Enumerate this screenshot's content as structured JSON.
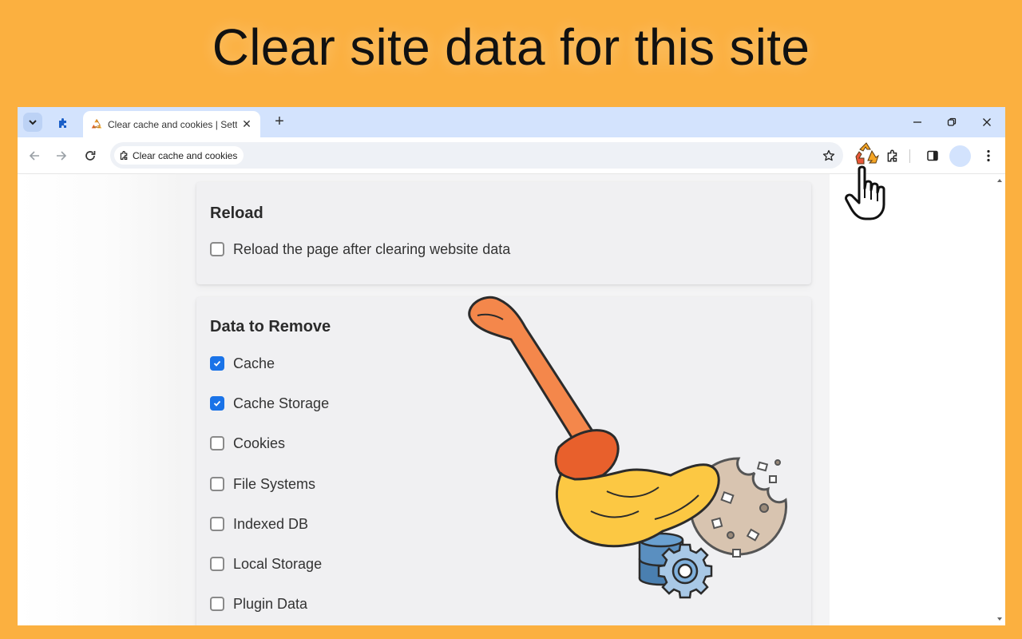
{
  "headline": "Clear site data for this site",
  "browser": {
    "tab": {
      "title": "Clear cache and cookies | Settings",
      "favicon": "recycle-icon"
    },
    "tabbar_icons": [
      "tab-search-icon",
      "extension-puzzle-icon",
      "new-tab-icon"
    ],
    "window_controls": [
      "minimize",
      "restore",
      "close"
    ],
    "toolbar": {
      "back": "arrow-left-icon",
      "forward": "arrow-right-icon",
      "reload": "reload-icon",
      "omnibox_chip_label": "Clear cache and cookies",
      "bookmark": "star-icon",
      "extension_active": "recycle-icon",
      "extensions_menu": "puzzle-icon",
      "side_panel": "side-panel-icon",
      "menu": "more-vert-icon"
    }
  },
  "page": {
    "reload_section": {
      "title": "Reload",
      "options": [
        {
          "label": "Reload the page after clearing website data",
          "checked": false
        }
      ]
    },
    "data_section": {
      "title": "Data to Remove",
      "options": [
        {
          "label": "Cache",
          "checked": true
        },
        {
          "label": "Cache Storage",
          "checked": true
        },
        {
          "label": "Cookies",
          "checked": false
        },
        {
          "label": "File Systems",
          "checked": false
        },
        {
          "label": "Indexed DB",
          "checked": false
        },
        {
          "label": "Local Storage",
          "checked": false
        },
        {
          "label": "Plugin Data",
          "checked": false
        }
      ]
    }
  },
  "illustration": [
    "broom-icon",
    "cookie-icon",
    "database-icon",
    "gear-icon"
  ],
  "cursor": "hand-pointer-icon",
  "colors": {
    "background": "#fbb040",
    "tabbar": "#d3e3fd",
    "checkbox_checked": "#1a73e8",
    "broom_handle": "#f4874b",
    "broom_bristles": "#fcc843"
  }
}
